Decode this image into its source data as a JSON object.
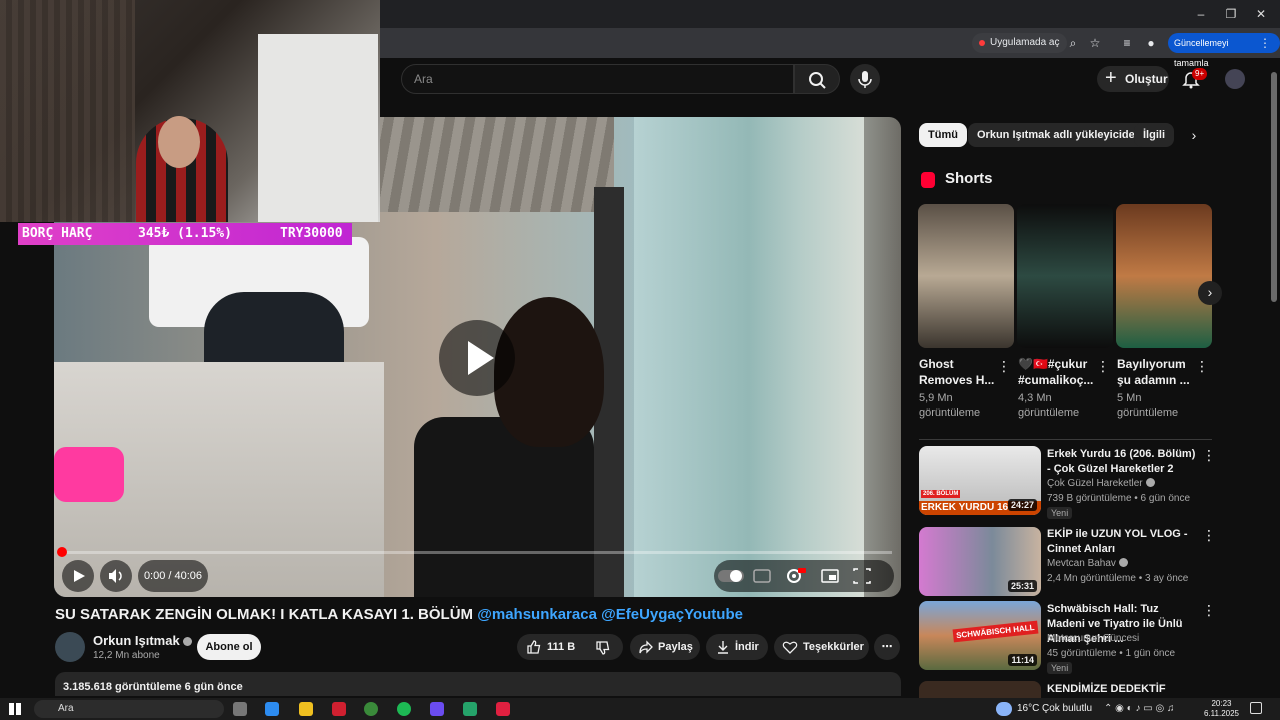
{
  "browser": {
    "open_in_app": "Uygulamada aç",
    "update_button": "Güncellemeyi tamamla"
  },
  "overlay": {
    "ticker_label": "BORÇ HARÇ",
    "ticker_value": "345₺ (1.15%)",
    "ticker_goal": "TRY30000"
  },
  "header": {
    "search_placeholder": "Ara",
    "create_label": "Oluştur",
    "notifications_badge": "9+"
  },
  "player": {
    "time": "0:00 / 40:06",
    "progress": 0.0
  },
  "video": {
    "title": "SU SATARAK ZENGİN OLMAK! I KATLA KASAYI 1. BÖLÜM",
    "title_link1": "@mahsunkaraca",
    "title_link2": "@EfeUygaçYoutube",
    "channel_name": "Orkun Işıtmak",
    "subscribers": "12,2 Mn abone",
    "subscribe_label": "Abone ol",
    "likes": "111 B",
    "share_label": "Paylaş",
    "download_label": "İndir",
    "thanks_label": "Teşekkürler",
    "description_meta": "3.185.618 görüntüleme  6 gün önce"
  },
  "sidebar": {
    "chips": [
      "Tümü",
      "Orkun Işıtmak adlı yükleyiciden",
      "İlgili"
    ],
    "shorts_title": "Shorts",
    "shorts": [
      {
        "title": "Ghost Removes H...",
        "views": "5,9 Mn görüntüleme"
      },
      {
        "title": "🖤🇹🇷#çukur #cumalikoç...",
        "views": "4,3 Mn görüntüleme"
      },
      {
        "title": "Bayılıyorum şu adamın ...",
        "views": "5 Mn görüntüleme"
      }
    ],
    "recommended": [
      {
        "title": "Erkek Yurdu 16 (206. Bölüm) - Çok Güzel Hareketler 2",
        "channel": "Çok Güzel Hareketler",
        "meta": "739 B görüntüleme • 6 gün önce",
        "badge": "Yeni",
        "duration": "24:27",
        "thumb_text": "ERKEK YURDU 16",
        "thumb_tag": "206. BÖLÜM"
      },
      {
        "title": "EKİP ile UZUN YOL VLOG - Cinnet Anları",
        "channel": "Mevtcan Bahav",
        "meta": "2,4 Mn görüntüleme • 3 ay önce",
        "badge": "",
        "duration": "25:31",
        "thumb_text": "",
        "thumb_tag": ""
      },
      {
        "title": "Schwäbisch Hall: Tuz Madeni ve Tiyatro ile Ünlü Alman Şehri ...",
        "channel": "Motorcunun Güncesi",
        "meta": "45 görüntüleme • 1 gün önce",
        "badge": "Yeni",
        "duration": "11:14",
        "thumb_text": "SCHWÄBISCH HALL",
        "thumb_tag": ""
      },
      {
        "title": "KENDİMİZE DEDEKTİF TUTTUK!",
        "channel": "",
        "meta": "",
        "badge": "",
        "duration": "",
        "thumb_text": "",
        "thumb_tag": ""
      }
    ]
  },
  "taskbar": {
    "search": "Ara",
    "temperature": "16°C",
    "weather": "Çok bulutlu",
    "time": "20:23",
    "date": "6.11.2025"
  }
}
